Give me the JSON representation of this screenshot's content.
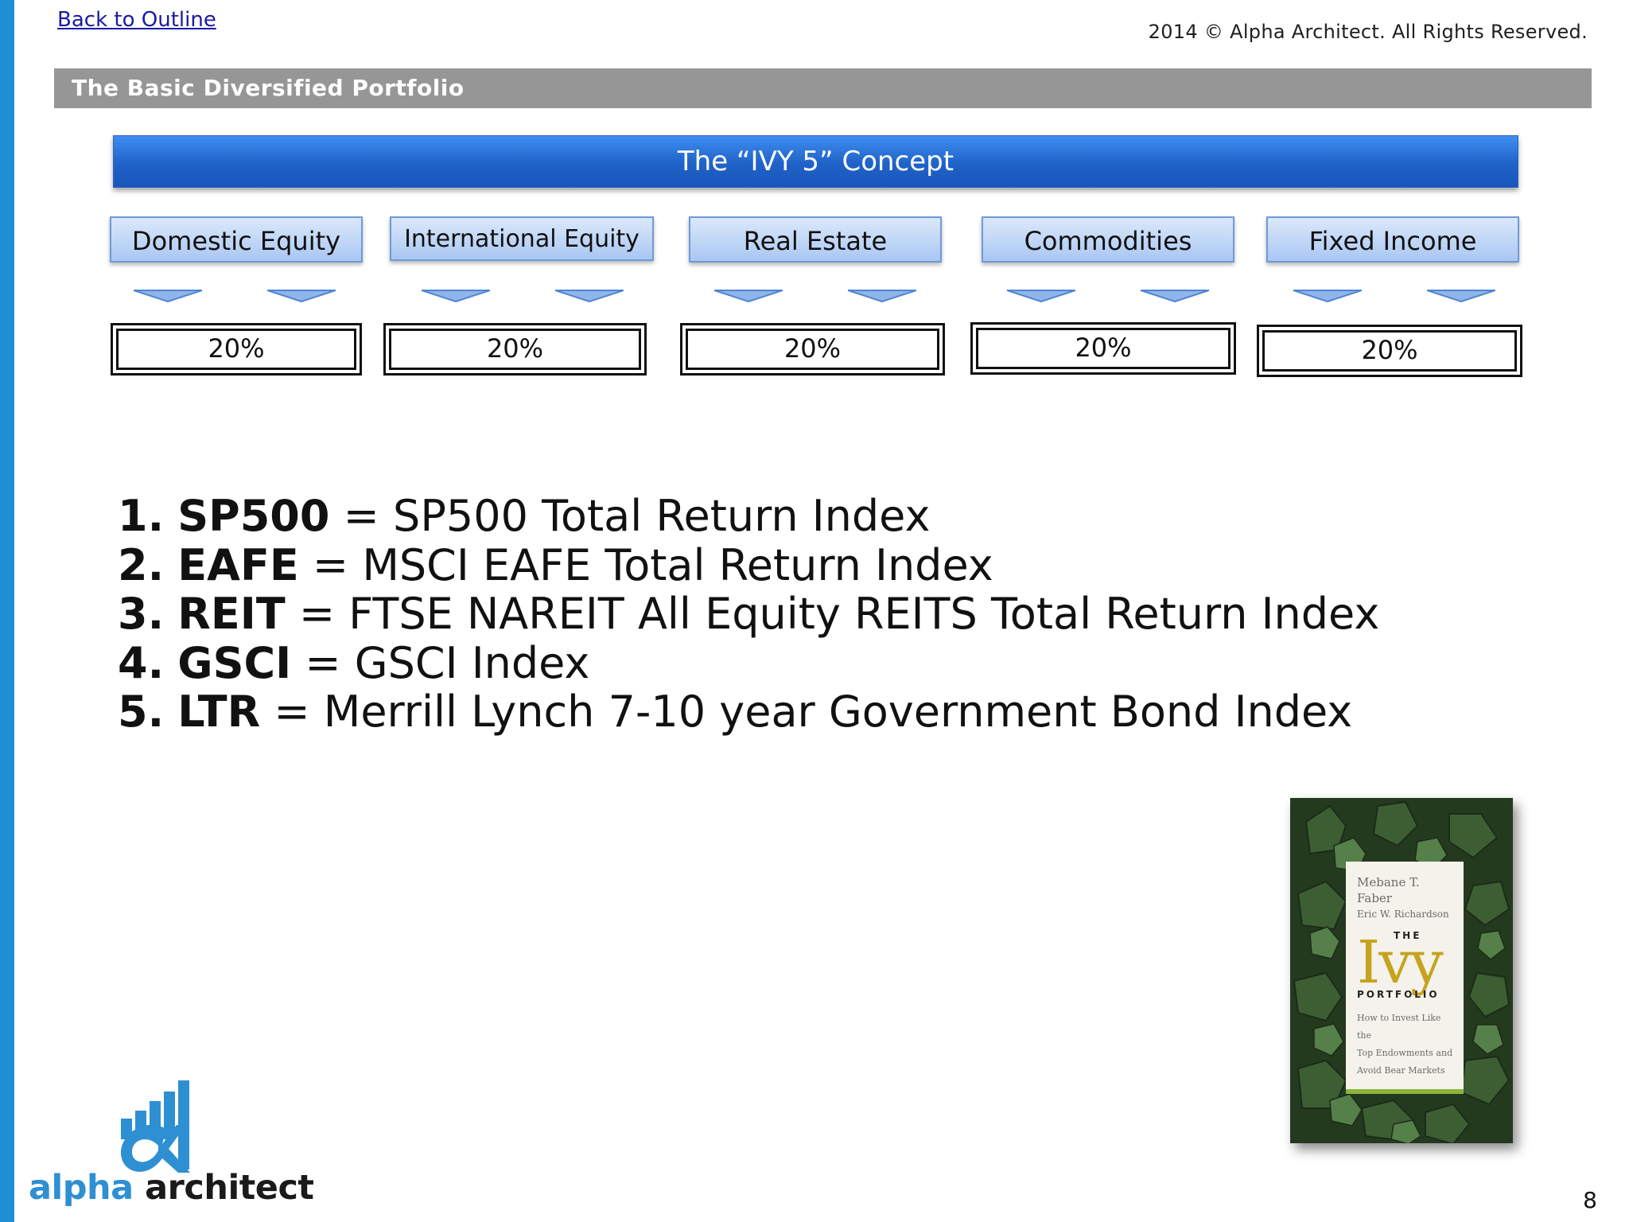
{
  "header": {
    "back_link": "Back to Outline",
    "copyright": "2014 © Alpha Architect. All Rights Reserved."
  },
  "section_title": "The Basic Diversified Portfolio",
  "concept_title": "The “IVY 5” Concept",
  "categories": [
    {
      "label": "Domestic Equity",
      "allocation": "20%"
    },
    {
      "label": "International Equity",
      "allocation": "20%"
    },
    {
      "label": "Real Estate",
      "allocation": "20%"
    },
    {
      "label": "Commodities",
      "allocation": "20%"
    },
    {
      "label": "Fixed Income",
      "allocation": "20%"
    }
  ],
  "indices": [
    {
      "num": "1.",
      "abbr": "SP500",
      "desc": "SP500 Total Return Index"
    },
    {
      "num": "2.",
      "abbr": "EAFE",
      "desc": "MSCI EAFE Total Return Index"
    },
    {
      "num": "3.",
      "abbr": "REIT",
      "desc": "FTSE NAREIT All Equity REITS Total Return Index"
    },
    {
      "num": "4.",
      "abbr": "GSCI",
      "desc": "GSCI Index"
    },
    {
      "num": "5.",
      "abbr": "LTR",
      "desc": "Merrill Lynch 7-10 year Government Bond Index"
    }
  ],
  "book": {
    "author1": "Mebane T. Faber",
    "author2": "Eric W. Richardson",
    "the": "THE",
    "title": "Ivy",
    "portfolio": "PORTFOLIO",
    "subtitle1": "How to Invest Like the",
    "subtitle2": "Top Endowments and",
    "subtitle3": "Avoid Bear Markets"
  },
  "logo": {
    "word1": "alpha",
    "word2": "architect"
  },
  "page_number": "8",
  "colors": {
    "accent_blue": "#1d8fd2",
    "banner_blue": "#1f62c8",
    "section_gray": "#969696"
  }
}
